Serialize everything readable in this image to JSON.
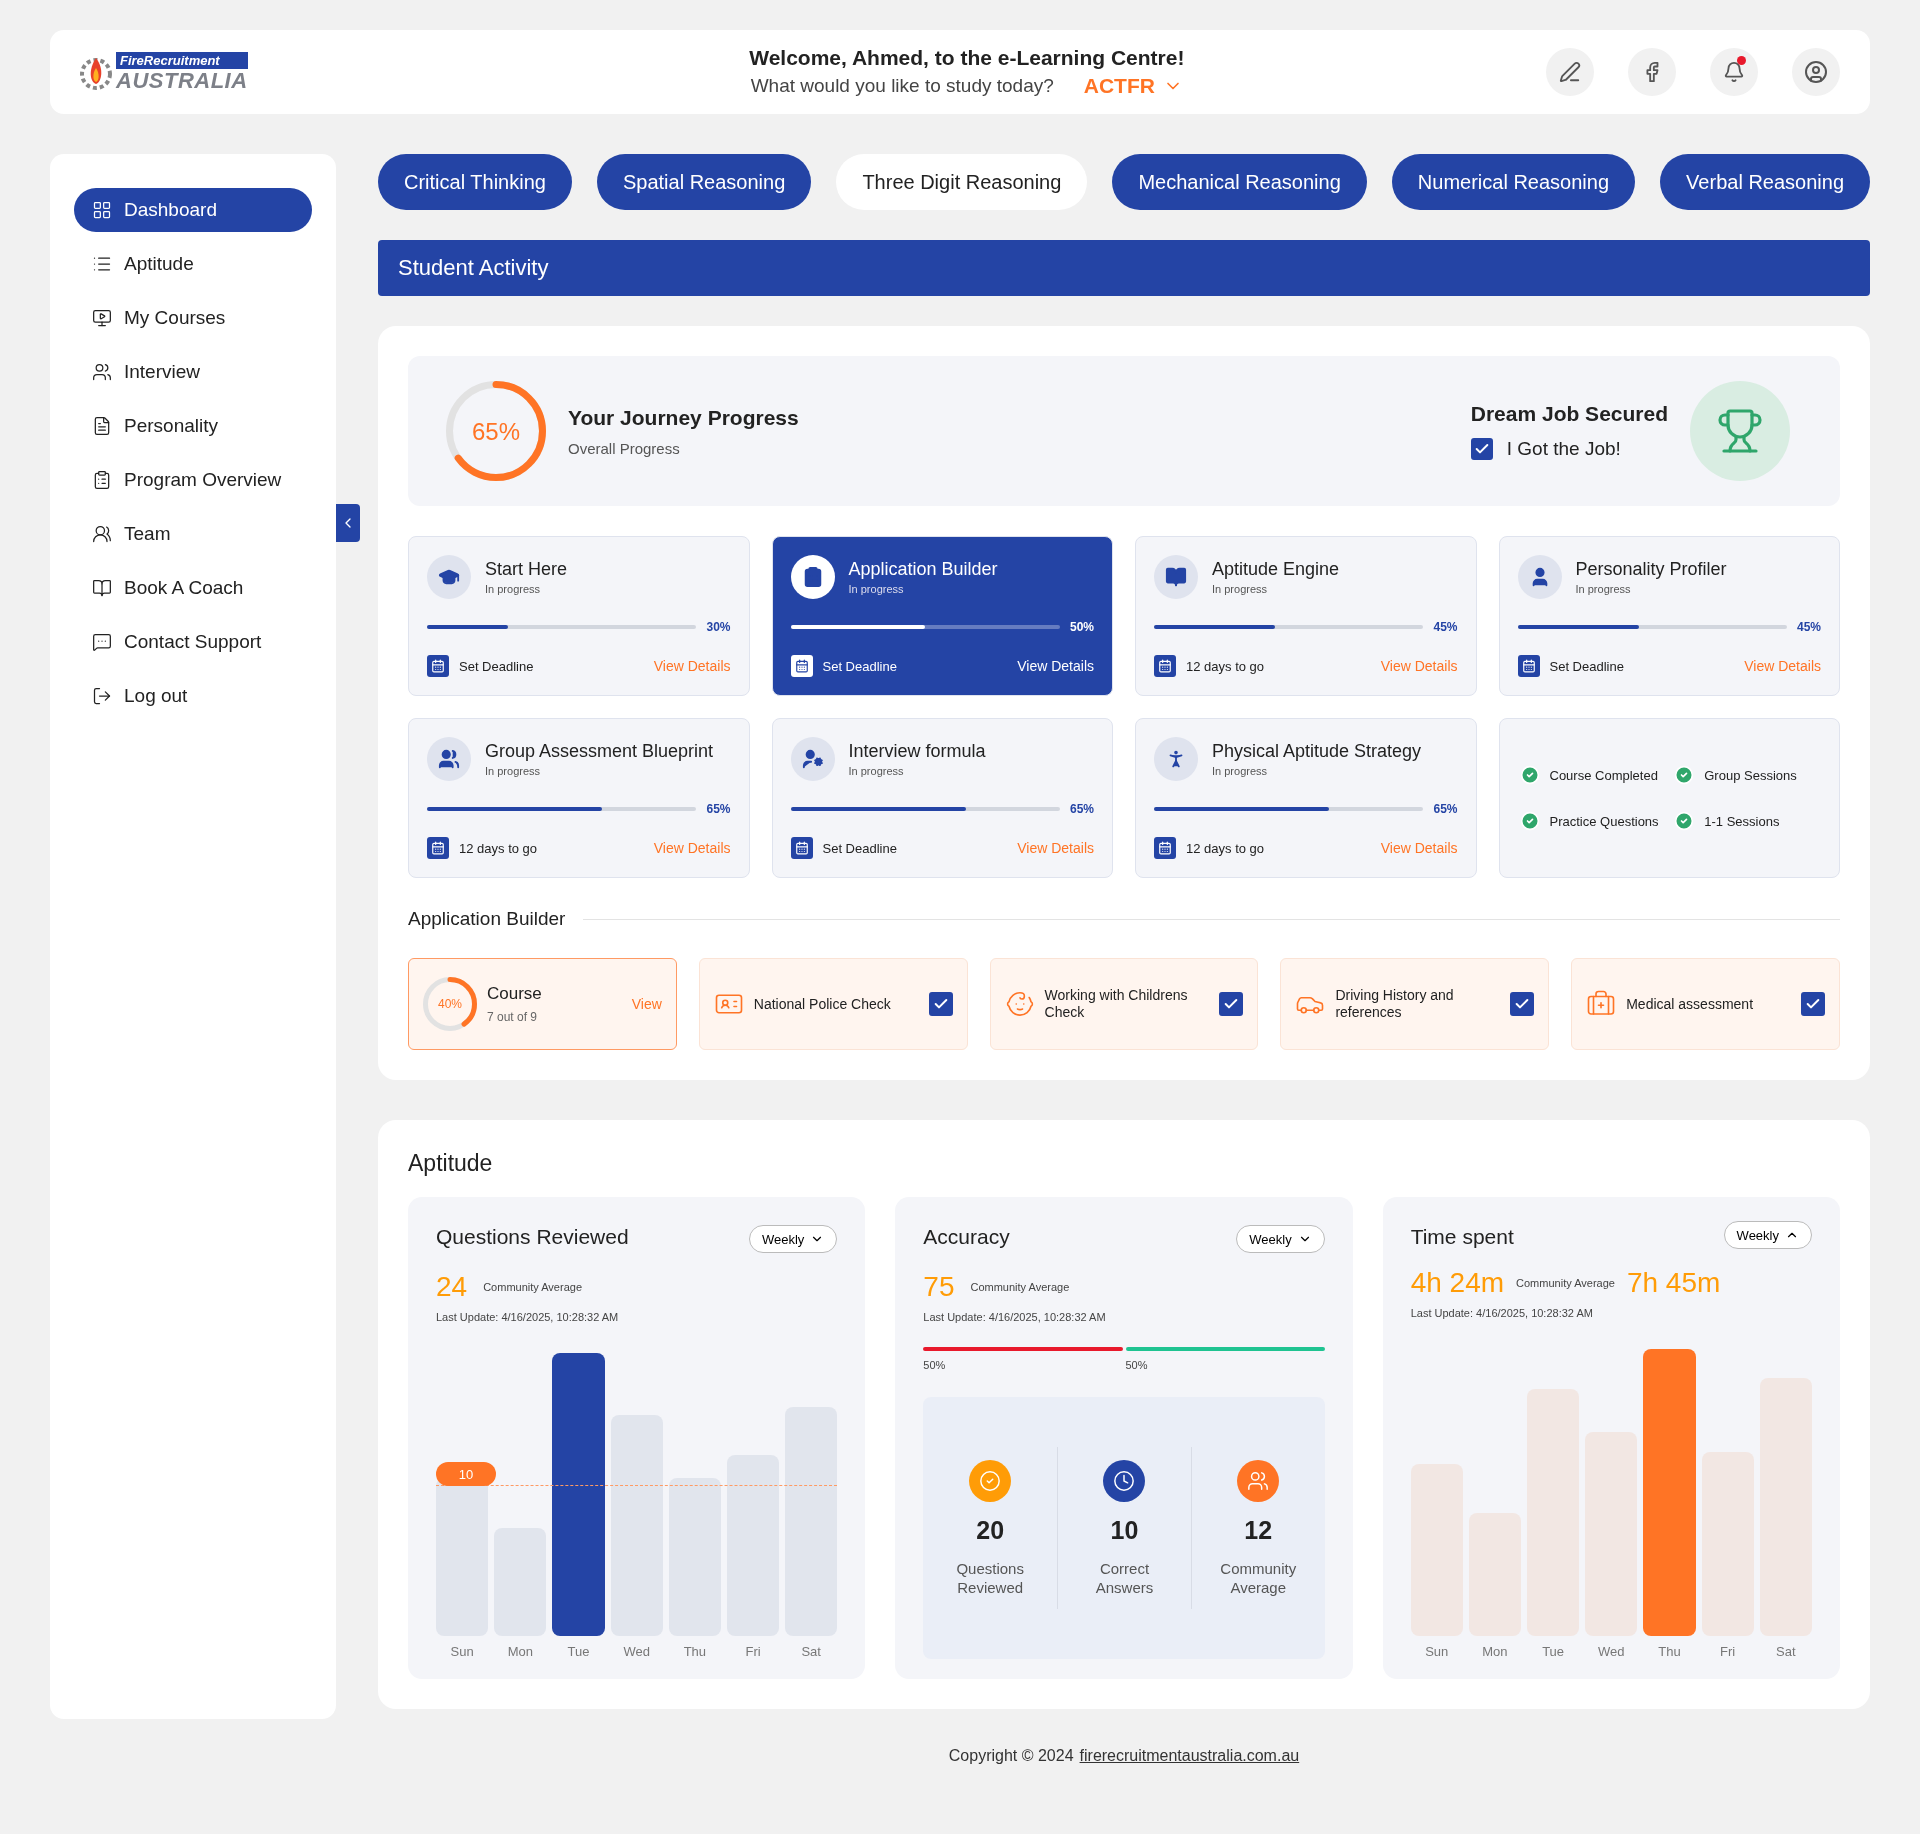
{
  "header": {
    "logo": {
      "top": "FireRecruitment",
      "bottom": "AUSTRALIA"
    },
    "welcome": "Welcome, Ahmed, to the e-Learning Centre!",
    "question": "What would you like to study today?",
    "course": "ACTFR",
    "notification_unread": true
  },
  "sidebar": {
    "items": [
      {
        "label": "Dashboard",
        "selected": true
      },
      {
        "label": "Aptitude",
        "selected": false
      },
      {
        "label": "My Courses",
        "selected": false
      },
      {
        "label": "Interview",
        "selected": false
      },
      {
        "label": "Personality",
        "selected": false
      },
      {
        "label": "Program Overview",
        "selected": false
      },
      {
        "label": "Team",
        "selected": false
      },
      {
        "label": "Book A Coach",
        "selected": false
      },
      {
        "label": "Contact Support",
        "selected": false
      },
      {
        "label": "Log out",
        "selected": false
      }
    ]
  },
  "topic_tabs": [
    {
      "label": "Critical Thinking",
      "selected": false
    },
    {
      "label": "Spatial Reasoning",
      "selected": false
    },
    {
      "label": "Three Digit Reasoning",
      "selected": true
    },
    {
      "label": "Mechanical Reasoning",
      "selected": false
    },
    {
      "label": "Numerical Reasoning",
      "selected": false
    },
    {
      "label": "Verbal Reasoning",
      "selected": false
    }
  ],
  "activity_title": "Student Activity",
  "journey": {
    "percent": "65%",
    "title": "Your Journey Progress",
    "subtitle": "Overall Progress"
  },
  "dream_job": {
    "title": "Dream Job Secured",
    "label": "I Got the Job!",
    "checked": true
  },
  "modules": [
    {
      "title": "Start Here",
      "status": "In progress",
      "level": 0.3,
      "percent": "30%",
      "footer": "Set Deadline",
      "link": "View Details",
      "selected": false
    },
    {
      "title": "Application Builder",
      "status": "In progress",
      "level": 0.5,
      "percent": "50%",
      "footer": "Set Deadline",
      "link": "View Details",
      "selected": true
    },
    {
      "title": "Aptitude Engine",
      "status": "In progress",
      "level": 0.45,
      "percent": "45%",
      "footer": "12 days to go",
      "link": "View Details",
      "selected": false
    },
    {
      "title": "Personality Profiler",
      "status": "In progress",
      "level": 0.45,
      "percent": "45%",
      "footer": "Set Deadline",
      "link": "View Details",
      "selected": false
    },
    {
      "title": "Group Assessment Blueprint",
      "status": "In progress",
      "level": 0.65,
      "percent": "65%",
      "footer": "12 days to go",
      "link": "View Details",
      "selected": false
    },
    {
      "title": "Interview formula",
      "status": "In progress",
      "level": 0.65,
      "percent": "65%",
      "footer": "Set Deadline",
      "link": "View Details",
      "selected": false
    },
    {
      "title": "Physical Aptitude Strategy",
      "status": "In progress",
      "level": 0.65,
      "percent": "65%",
      "footer": "12 days to go",
      "link": "View Details",
      "selected": false
    }
  ],
  "achievements": [
    {
      "label": "Course Completed",
      "checked": true
    },
    {
      "label": "Group Sessions",
      "checked": true
    },
    {
      "label": "Practice Questions",
      "checked": true
    },
    {
      "label": "1-1 Sessions",
      "checked": true
    }
  ],
  "application_builder": {
    "title": "Application Builder",
    "course": {
      "percent": "40%",
      "title": "Course",
      "subtitle": "7 out of 9",
      "link": "View"
    },
    "checks": [
      {
        "kind": "police",
        "label": "National Police Check",
        "checked": true
      },
      {
        "kind": "children",
        "label": "Working with Childrens Check",
        "checked": true
      },
      {
        "kind": "driving",
        "label": "Driving History and references",
        "checked": true
      },
      {
        "kind": "medical",
        "label": "Medical assessment",
        "checked": true
      }
    ]
  },
  "aptitude": {
    "title": "Aptitude",
    "questions": {
      "title": "Questions Reviewed",
      "period": "Weekly",
      "expanded": false,
      "value": "24",
      "value_label": "Community Average",
      "update": "Last Update: 4/16/2025, 10:28:32 AM",
      "reference": "10",
      "days": [
        {
          "label": "Sun",
          "selected": false
        },
        {
          "label": "Mon",
          "selected": false
        },
        {
          "label": "Tue",
          "selected": true
        },
        {
          "label": "Wed",
          "selected": false
        },
        {
          "label": "Thu",
          "selected": false
        },
        {
          "label": "Fri",
          "selected": false
        },
        {
          "label": "Sat",
          "selected": false
        }
      ]
    },
    "accuracy": {
      "title": "Accuracy",
      "period": "Weekly",
      "expanded": false,
      "value": "75",
      "value_label": "Community Average",
      "update": "Last Update: 4/16/2025, 10:28:32 AM",
      "split": [
        {
          "label": "50%",
          "color": "#e8192c"
        },
        {
          "label": "50%",
          "color": "#1fc391"
        }
      ],
      "stats": [
        {
          "value": "20",
          "label": "Questions Reviewed",
          "kind": "check",
          "color": "#ff9c07"
        },
        {
          "value": "10",
          "label": "Correct Answers",
          "kind": "clock",
          "color": "#2444a5"
        },
        {
          "value": "12",
          "label": "Community Average",
          "kind": "group",
          "color": "#ff7425"
        }
      ]
    },
    "time": {
      "title": "Time spent",
      "period": "Weekly",
      "expanded": true,
      "value": "4h 24m",
      "value_label": "Community Average",
      "community_value": "7h 45m",
      "update": "Last Update: 4/16/2025, 10:28:32 AM",
      "days": [
        {
          "label": "Sun",
          "selected": false
        },
        {
          "label": "Mon",
          "selected": false
        },
        {
          "label": "Tue",
          "selected": false
        },
        {
          "label": "Wed",
          "selected": false
        },
        {
          "label": "Thu",
          "selected": true
        },
        {
          "label": "Fri",
          "selected": false
        },
        {
          "label": "Sat",
          "selected": false
        }
      ]
    }
  },
  "footer": {
    "text": "Copyright © 2024",
    "link": "firerecruitmentaustralia.com.au"
  }
}
